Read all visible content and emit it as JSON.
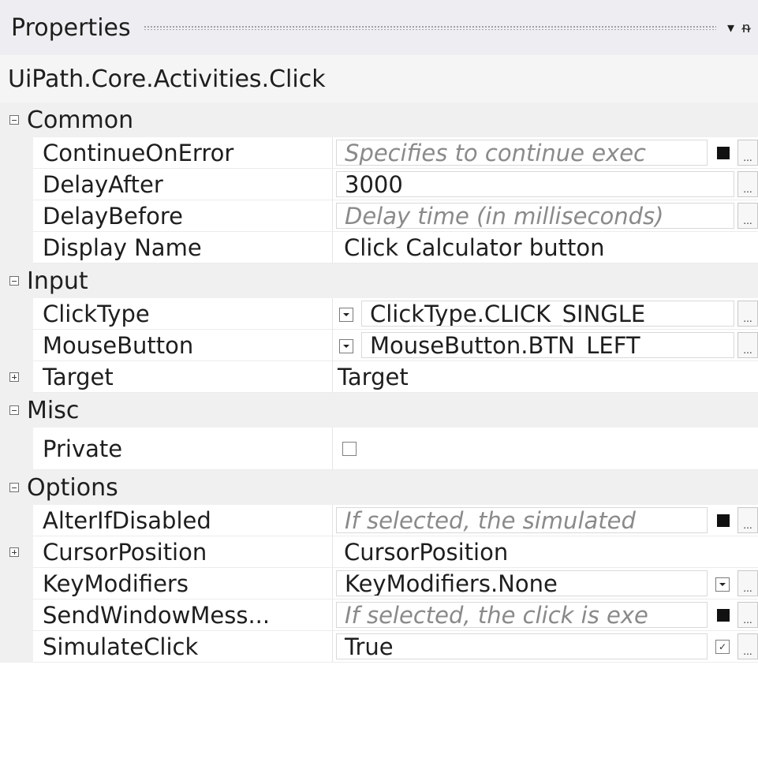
{
  "panel": {
    "title": "Properties",
    "dropdown_glyph": "▾",
    "pin_glyph": "ᵰ",
    "subject": "UiPath.Core.Activities.Click"
  },
  "categories": {
    "common": "Common",
    "input": "Input",
    "misc": "Misc",
    "options": "Options"
  },
  "props": {
    "continue_on_error": {
      "name": "ContinueOnError",
      "placeholder": "Specifies to continue exec"
    },
    "delay_after": {
      "name": "DelayAfter",
      "value": "3000"
    },
    "delay_before": {
      "name": "DelayBefore",
      "placeholder": "Delay time (in milliseconds)"
    },
    "display_name": {
      "name": "Display Name",
      "value": "Click Calculator button"
    },
    "click_type": {
      "name": "ClickType",
      "value": "ClickType.CLICK_SINGLE"
    },
    "mouse_button": {
      "name": "MouseButton",
      "value": "MouseButton.BTN_LEFT"
    },
    "target": {
      "name": "Target",
      "value": "Target"
    },
    "private": {
      "name": "Private",
      "checked": false
    },
    "alter_if_disabled": {
      "name": "AlterIfDisabled",
      "placeholder": "If selected, the simulated"
    },
    "cursor_position": {
      "name": "CursorPosition",
      "value": "CursorPosition"
    },
    "key_modifiers": {
      "name": "KeyModifiers",
      "value": "KeyModifiers.None"
    },
    "send_window_messages": {
      "name": "SendWindowMess...",
      "placeholder": "If selected, the click is exe"
    },
    "simulate_click": {
      "name": "SimulateClick",
      "value": "True",
      "check_glyph": "✓"
    }
  },
  "ellipsis_label": "..."
}
